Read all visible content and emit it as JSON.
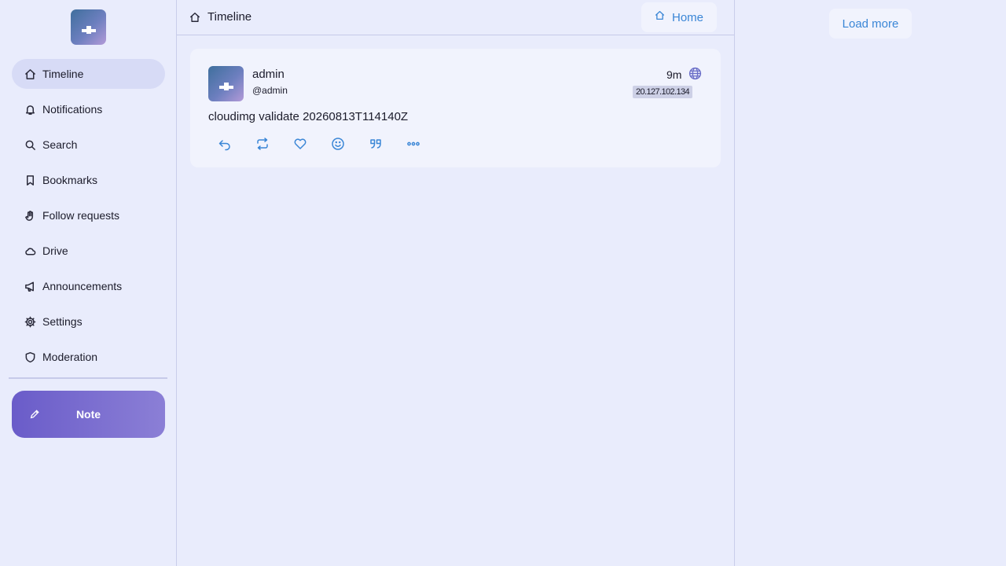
{
  "sidebar": {
    "items": [
      {
        "label": "Timeline",
        "icon": "home-icon",
        "active": true
      },
      {
        "label": "Notifications",
        "icon": "bell-icon"
      },
      {
        "label": "Search",
        "icon": "search-icon"
      },
      {
        "label": "Bookmarks",
        "icon": "bookmark-icon"
      },
      {
        "label": "Follow requests",
        "icon": "hand-icon"
      },
      {
        "label": "Drive",
        "icon": "cloud-icon"
      },
      {
        "label": "Announcements",
        "icon": "megaphone-icon"
      },
      {
        "label": "Settings",
        "icon": "gear-icon"
      },
      {
        "label": "Moderation",
        "icon": "shield-icon"
      }
    ],
    "note_button_label": "Note"
  },
  "header": {
    "title": "Timeline",
    "tab_label": "Home"
  },
  "note": {
    "display_name": "admin",
    "username": "@admin",
    "time": "9m",
    "instance": "20.127.102.134",
    "text": "cloudimg validate 20260813T114140Z",
    "actions": [
      "reply-icon",
      "renote-icon",
      "heart-icon",
      "emoji-icon",
      "quote-icon",
      "more-icon"
    ]
  },
  "right": {
    "load_more_label": "Load more"
  },
  "colors": {
    "background": "#e9ecfc",
    "accent": "#3a86d6",
    "note_button_start": "#6a5cc9",
    "note_button_end": "#8b7fd6",
    "active_nav": "#d7dbf6"
  }
}
